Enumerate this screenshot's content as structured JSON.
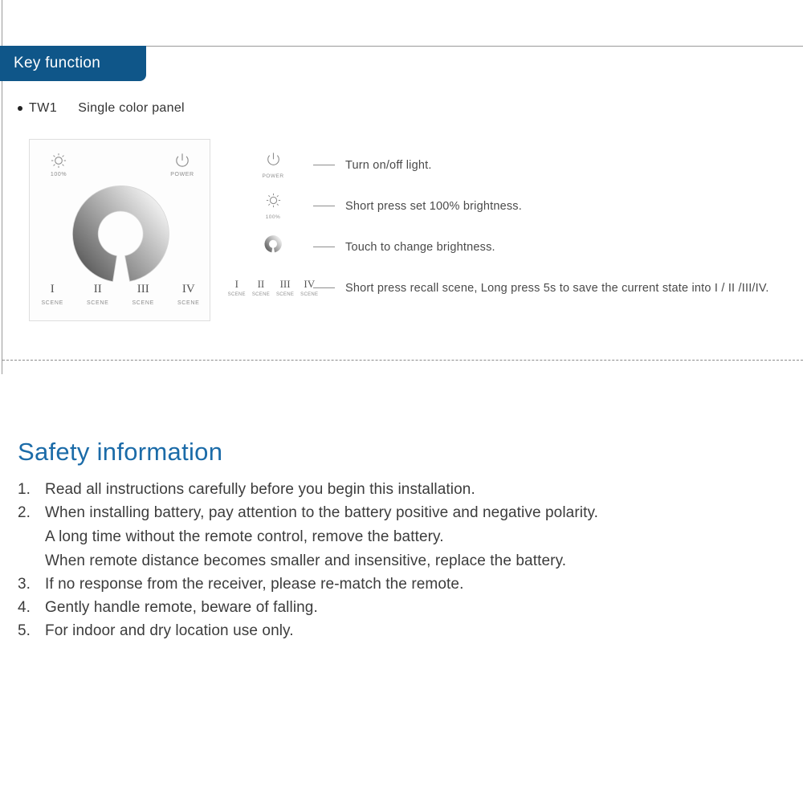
{
  "header": {
    "banner_label": "Key function"
  },
  "product": {
    "bullet": "●",
    "model": "TW1",
    "description": "Single color panel"
  },
  "device_panel": {
    "brightness_button": {
      "icon": "sun-brightness-icon",
      "caption": "100%"
    },
    "power_button": {
      "icon": "power-icon",
      "caption": "POWER"
    },
    "dimmer_ring": {
      "icon": "dimmer-ring-icon"
    },
    "scene_buttons": [
      {
        "numeral": "I",
        "caption": "SCENE"
      },
      {
        "numeral": "II",
        "caption": "SCENE"
      },
      {
        "numeral": "III",
        "caption": "SCENE"
      },
      {
        "numeral": "IV",
        "caption": "SCENE"
      }
    ]
  },
  "legend": {
    "rows": [
      {
        "icon": "power-icon",
        "icon_caption": "POWER",
        "text": "Turn on/off light."
      },
      {
        "icon": "sun-brightness-icon",
        "icon_caption": "100%",
        "text": "Short press set 100% brightness."
      },
      {
        "icon": "dimmer-ring-icon",
        "icon_caption": "",
        "text": "Touch to change brightness."
      },
      {
        "icon": "scene-numerals-icon",
        "icon_caption": "",
        "text": "Short press recall scene, Long press 5s to save the current state into I / II /III/IV.",
        "numerals": [
          {
            "numeral": "I",
            "caption": "SCENE"
          },
          {
            "numeral": "II",
            "caption": "SCENE"
          },
          {
            "numeral": "III",
            "caption": "SCENE"
          },
          {
            "numeral": "IV",
            "caption": "SCENE"
          }
        ]
      }
    ]
  },
  "safety": {
    "heading": "Safety information",
    "items": [
      {
        "number": "1.",
        "text": "Read all instructions carefully before you begin this installation.",
        "continuations": []
      },
      {
        "number": "2.",
        "text": "When installing battery, pay attention to the battery positive and negative polarity.",
        "continuations": [
          "A long time without the remote control, remove the battery.",
          "When remote distance becomes smaller and insensitive, replace the battery."
        ]
      },
      {
        "number": "3.",
        "text": "If no response from the receiver, please re-match the remote.",
        "continuations": []
      },
      {
        "number": "4.",
        "text": "Gently handle remote, beware of falling.",
        "continuations": []
      },
      {
        "number": "5.",
        "text": "For indoor and dry location use only.",
        "continuations": []
      }
    ]
  },
  "colors": {
    "banner_blue": "#0f5689",
    "heading_blue": "#1b6ba8",
    "rule_gray": "#9a9a9a",
    "body_gray": "#3c3c3c",
    "caption_gray": "#8d8d8d"
  }
}
